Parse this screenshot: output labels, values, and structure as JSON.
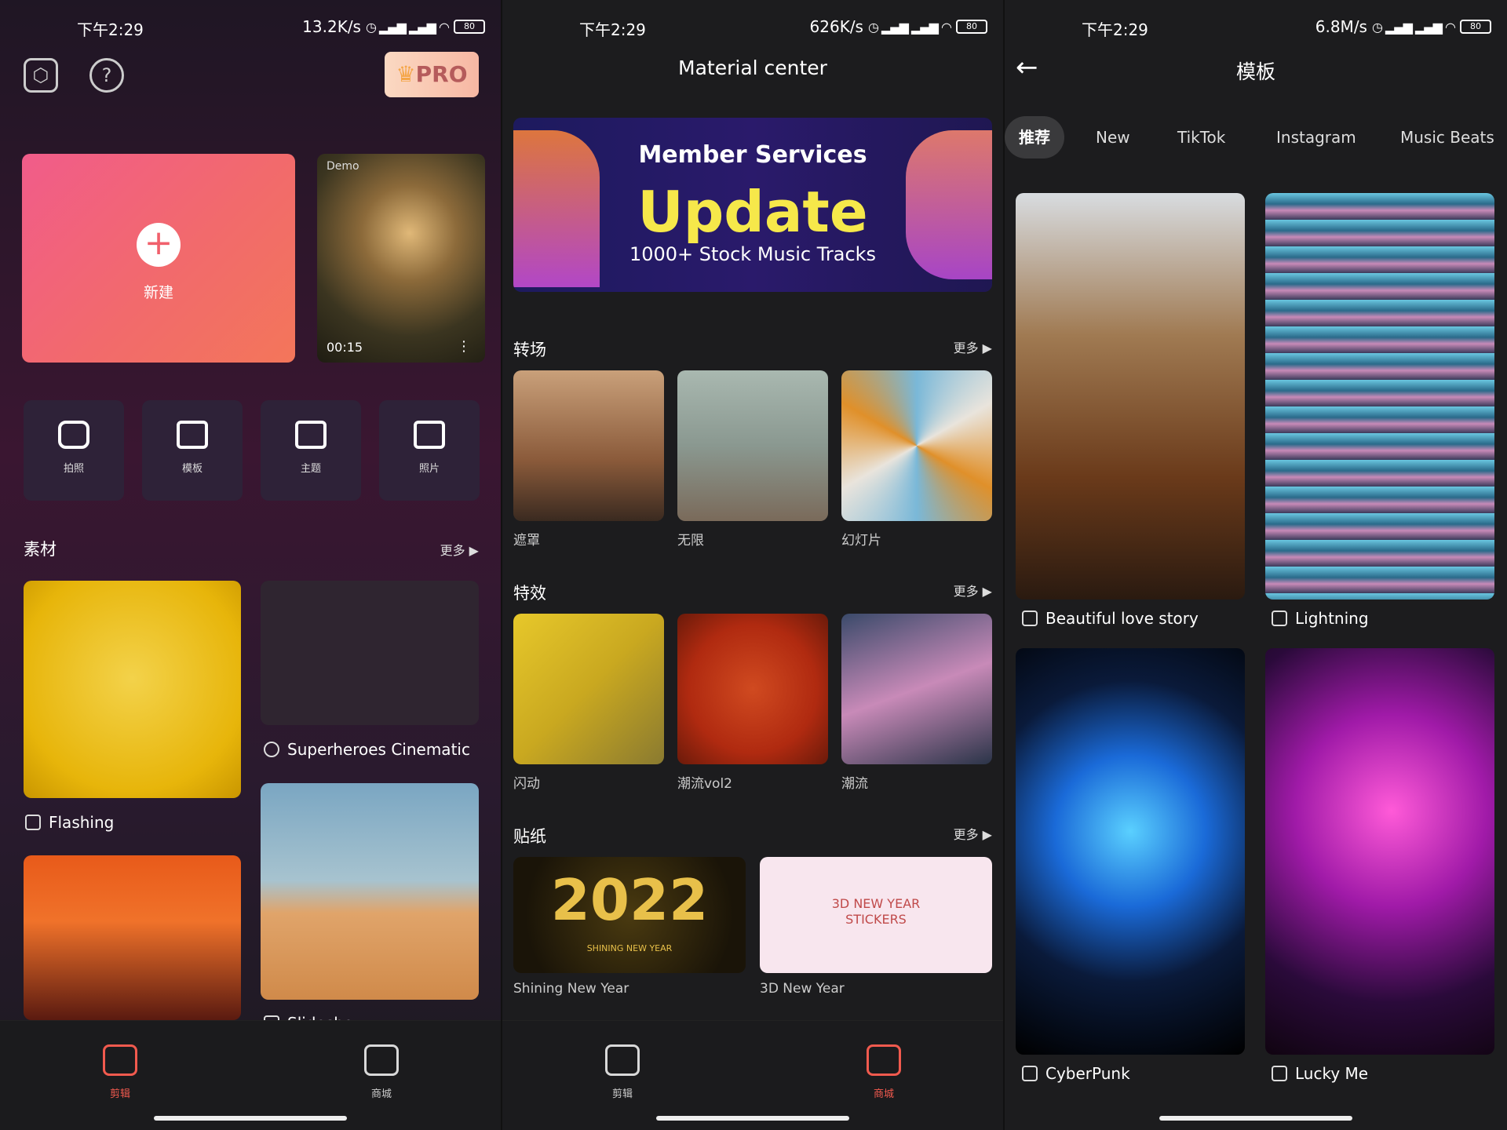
{
  "status_bars": [
    {
      "time": "下午2:29",
      "speed": "13.2K/s",
      "battery": "80"
    },
    {
      "time": "下午2:29",
      "speed": "626K/s",
      "battery": "80"
    },
    {
      "time": "下午2:29",
      "speed": "6.8M/s",
      "battery": "80"
    }
  ],
  "screen1": {
    "pro_label": "PRO",
    "new_project_label": "新建",
    "demo": {
      "tag": "Demo",
      "duration": "00:15"
    },
    "quick_actions": [
      "拍照",
      "模板",
      "主题",
      "照片"
    ],
    "materials_title": "素材",
    "more_label": "更多 ▶",
    "materials": [
      "Flashing",
      "Superheroes Cinematic",
      "Slideshow"
    ],
    "nav": {
      "edit": "剪辑",
      "store": "商城"
    }
  },
  "screen2": {
    "title": "Material center",
    "banner": {
      "line1": "Member Services",
      "line2": "Update",
      "line3": "1000+ Stock Music Tracks"
    },
    "sections": [
      {
        "title": "转场",
        "more": "更多 ▶",
        "items": [
          "遮罩",
          "无限",
          "幻灯片"
        ]
      },
      {
        "title": "特效",
        "more": "更多 ▶",
        "items": [
          "闪动",
          "潮流vol2",
          "潮流"
        ]
      },
      {
        "title": "贴纸",
        "more": "更多 ▶",
        "items": [
          "Shining New Year",
          "3D New Year"
        ]
      }
    ],
    "sticker_art": {
      "year": "2022",
      "year_sub": "SHINING NEW YEAR",
      "newyear": "3D NEW YEAR STICKERS"
    },
    "nav": {
      "edit": "剪辑",
      "store": "商城"
    }
  },
  "screen3": {
    "title": "模板",
    "tabs": [
      "推荐",
      "New",
      "TikTok",
      "Instagram",
      "Music Beats"
    ],
    "templates": [
      "Beautiful love story",
      "Lightning",
      "CyberPunk",
      "Lucky Me"
    ]
  }
}
